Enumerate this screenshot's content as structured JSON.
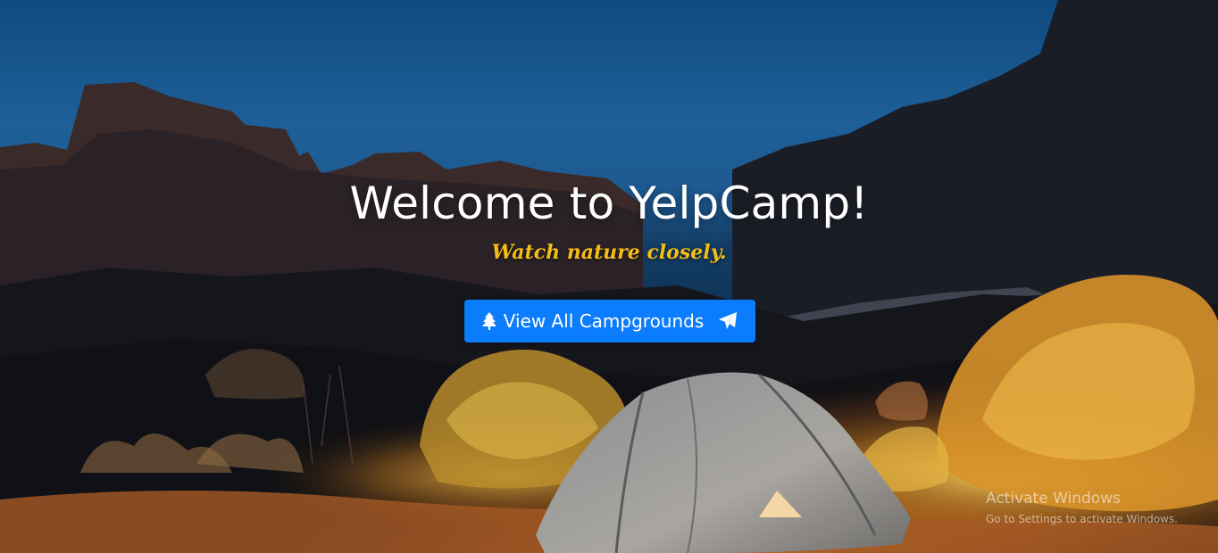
{
  "hero": {
    "title": "Welcome to YelpCamp!",
    "tagline": "Watch nature closely."
  },
  "cta": {
    "label": "View All Campgrounds",
    "leading_icon": "tree-icon",
    "trailing_icon": "paper-plane-icon"
  },
  "os_watermark": {
    "title": "Activate Windows",
    "subtitle": "Go to Settings to activate Windows."
  },
  "colors": {
    "sky": "#1e5f98",
    "button": "#0b7cfc",
    "tagline": "#f4bd16",
    "title": "#ffffff"
  }
}
